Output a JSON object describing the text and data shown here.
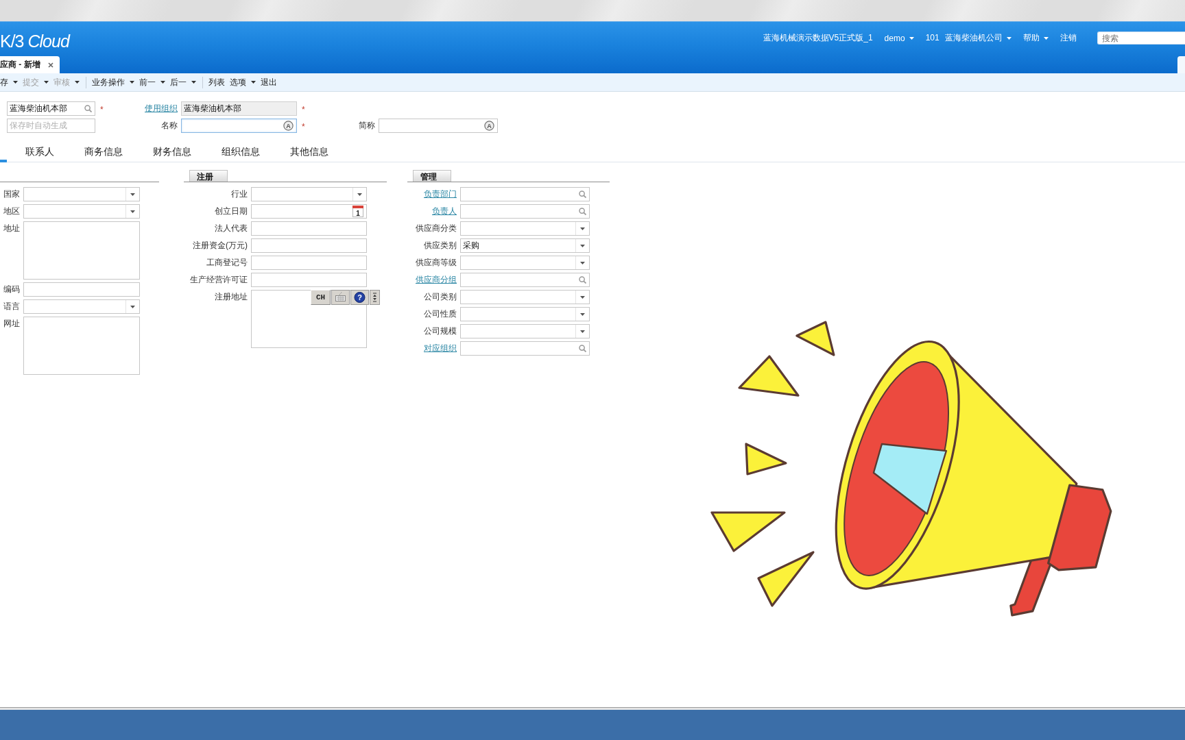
{
  "header": {
    "logo": "K/3 *Cloud*",
    "nav": [
      {
        "label": "蓝海机械演示数据V5正式版_1",
        "dropdown": false
      },
      {
        "label": "demo",
        "dropdown": true
      },
      {
        "label": "101 蓝海柴油机公司",
        "dropdown": true
      },
      {
        "label": "帮助",
        "dropdown": true
      },
      {
        "label": "注销",
        "dropdown": false
      }
    ],
    "search": {
      "placeholder": "搜索"
    }
  },
  "document_tabs": [
    {
      "label": "应商 - 新增",
      "selected": true,
      "closable": true
    },
    {
      "selected": false,
      "closable": false
    }
  ],
  "toolbar": [
    {
      "kind": "button",
      "label": "存",
      "dropdown": true,
      "disabled": false
    },
    {
      "kind": "button",
      "label": "提交",
      "dropdown": true,
      "disabled": true
    },
    {
      "kind": "button",
      "label": "审核",
      "dropdown": true,
      "disabled": true
    },
    {
      "kind": "separator"
    },
    {
      "kind": "button",
      "label": "业务操作",
      "dropdown": true,
      "disabled": false
    },
    {
      "kind": "button",
      "label": "前一",
      "dropdown": true,
      "disabled": false
    },
    {
      "kind": "button",
      "label": "后一",
      "dropdown": true,
      "disabled": false
    },
    {
      "kind": "separator"
    },
    {
      "kind": "button",
      "label": "列表",
      "dropdown": false,
      "disabled": false
    },
    {
      "kind": "button",
      "label": "选项",
      "dropdown": true,
      "disabled": false
    },
    {
      "kind": "button",
      "label": "退出",
      "dropdown": false,
      "disabled": false
    }
  ],
  "header_form": [
    [
      {
        "kind": "lookup",
        "value": "蓝海柴油机本部",
        "required_mark": "*",
        "disabled": false,
        "focused": false
      },
      {
        "label": "使用组织",
        "link": true,
        "kind": "text",
        "value": "蓝海柴油机本部",
        "required_mark": "*",
        "disabled": true,
        "focused": false
      }
    ],
    [
      {
        "kind": "text",
        "placeholder": "保存时自动生成",
        "disabled": false,
        "focused": false
      },
      {
        "label": "名称",
        "link": false,
        "kind": "multilang",
        "badge": "A",
        "required_mark": "*",
        "disabled": false,
        "focused": true
      },
      {
        "label": "简称",
        "link": false,
        "kind": "multilang",
        "badge": "A",
        "disabled": false,
        "focused": false
      }
    ]
  ],
  "detail_tabs": [
    {
      "selected": true
    },
    {
      "label": "联系人",
      "selected": false
    },
    {
      "label": "商务信息",
      "selected": false
    },
    {
      "label": "财务信息",
      "selected": false
    },
    {
      "label": "组织信息",
      "selected": false
    },
    {
      "label": "其他信息",
      "selected": false
    }
  ],
  "sections": [
    {
      "fields": [
        {
          "label": "国家",
          "link": false,
          "kind": "dropdown"
        },
        {
          "label": "地区",
          "link": false,
          "kind": "dropdown"
        },
        {
          "label": "地址",
          "link": false,
          "kind": "textarea"
        },
        {
          "label": "编码",
          "link": false,
          "kind": "text"
        },
        {
          "label": "语言",
          "link": false,
          "kind": "dropdown"
        },
        {
          "label": "网址",
          "link": false,
          "kind": "textarea"
        }
      ]
    },
    {
      "title": "注册",
      "fields": [
        {
          "label": "行业",
          "link": false,
          "kind": "dropdown"
        },
        {
          "label": "创立日期",
          "link": false,
          "kind": "date",
          "calendar_day": "1"
        },
        {
          "label": "法人代表",
          "link": false,
          "kind": "text"
        },
        {
          "label": "注册资金(万元)",
          "link": false,
          "kind": "text"
        },
        {
          "label": "工商登记号",
          "link": false,
          "kind": "text"
        },
        {
          "label": "生产经营许可证",
          "link": false,
          "kind": "text"
        },
        {
          "label": "注册地址",
          "link": false,
          "kind": "textarea",
          "ime_toolbar": {
            "label": "CH",
            "help": "?"
          }
        }
      ]
    },
    {
      "title": "管理",
      "fields": [
        {
          "label": "负责部门",
          "link": true,
          "kind": "lookup"
        },
        {
          "label": "负责人",
          "link": true,
          "kind": "lookup"
        },
        {
          "label": "供应商分类",
          "link": false,
          "kind": "dropdown"
        },
        {
          "label": "供应类别",
          "link": false,
          "kind": "dropdown",
          "value": "采购"
        },
        {
          "label": "供应商等级",
          "link": false,
          "kind": "dropdown"
        },
        {
          "label": "供应商分组",
          "link": true,
          "kind": "lookup"
        },
        {
          "label": "公司类别",
          "link": false,
          "kind": "dropdown"
        },
        {
          "label": "公司性质",
          "link": false,
          "kind": "dropdown"
        },
        {
          "label": "公司规模",
          "link": false,
          "kind": "dropdown"
        },
        {
          "label": "对应组织",
          "link": true,
          "kind": "lookup"
        }
      ]
    }
  ],
  "sticker": {
    "kind": "megaphone"
  }
}
